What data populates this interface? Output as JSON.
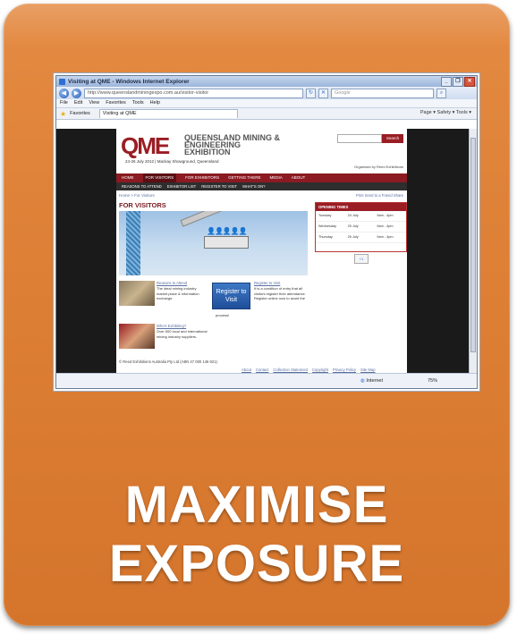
{
  "caption": {
    "line1": "MAXIMISE",
    "line2": "EXPOSURE"
  },
  "colors": {
    "tile": "#dd7f35",
    "brand": "#9a1d24",
    "caption": "#ffffff"
  },
  "browser": {
    "title": "Visiting at QME - Windows Internet Explorer",
    "url": "http://www.queenslandminingexpo.com.au/visitor-visitor",
    "search_placeholder": "Google",
    "menu": [
      "File",
      "Edit",
      "View",
      "Favorites",
      "Tools",
      "Help"
    ],
    "favorites_label": "Favorites",
    "tab_label": "Visiting at QME",
    "command_bar": "Page ▾  Safety ▾  Tools ▾",
    "status_zone": "Internet",
    "status_zoom": "75%"
  },
  "site": {
    "logo_mark": "QME",
    "logo_name": "QUEENSLAND MINING & ENGINEERING EXHIBITION",
    "logo_date": "24-26 July 2012 | Mackay Showground, Queensland",
    "search_button": "Search",
    "sponsor": "Organised by Reed Exhibitions",
    "nav": [
      "HOME",
      "FOR VISITORS",
      "FOR EXHIBITORS",
      "GETTING THERE",
      "MEDIA",
      "ABOUT"
    ],
    "subnav": [
      "REASONS TO ATTEND",
      "EXHIBITOR LIST",
      "REGISTER TO VISIT",
      "WHAT'S ON?"
    ],
    "breadcrumb": "Home > For Visitors",
    "tools": "Print  Send to a Friend  Share",
    "page_title": "FOR VISITORS",
    "reasons_title": "Reasons to Attend",
    "reasons_text": "The ideal mining industry market place & information exchange.",
    "register_button": "Register to Visit",
    "register_title": "Register to Visit",
    "register_text": "It is a condition of entry that all visitors register their attendance. Register online now to avoid the",
    "register_text_end": "process!",
    "exhibiting_title": "Who's Exhibiting?",
    "exhibiting_text": "Over 500 local and international mining industry suppliers.",
    "copyright": "© Reed Exhibitions Australia Pty Ltd (ABN 47 000 146 921)",
    "footer_links": [
      "About",
      "Contact",
      "Collection Statement",
      "Copyright",
      "Privacy Policy",
      "Site Map"
    ],
    "opening_times": {
      "heading": "OPENING TIMES",
      "rows": [
        [
          "Tuesday",
          "24 July",
          "9am - 4pm"
        ],
        [
          "Wednesday",
          "25 July",
          "9am - 4pm"
        ],
        [
          "Thursday",
          "26 July",
          "9am - 4pm"
        ]
      ]
    },
    "badge": "+1"
  }
}
